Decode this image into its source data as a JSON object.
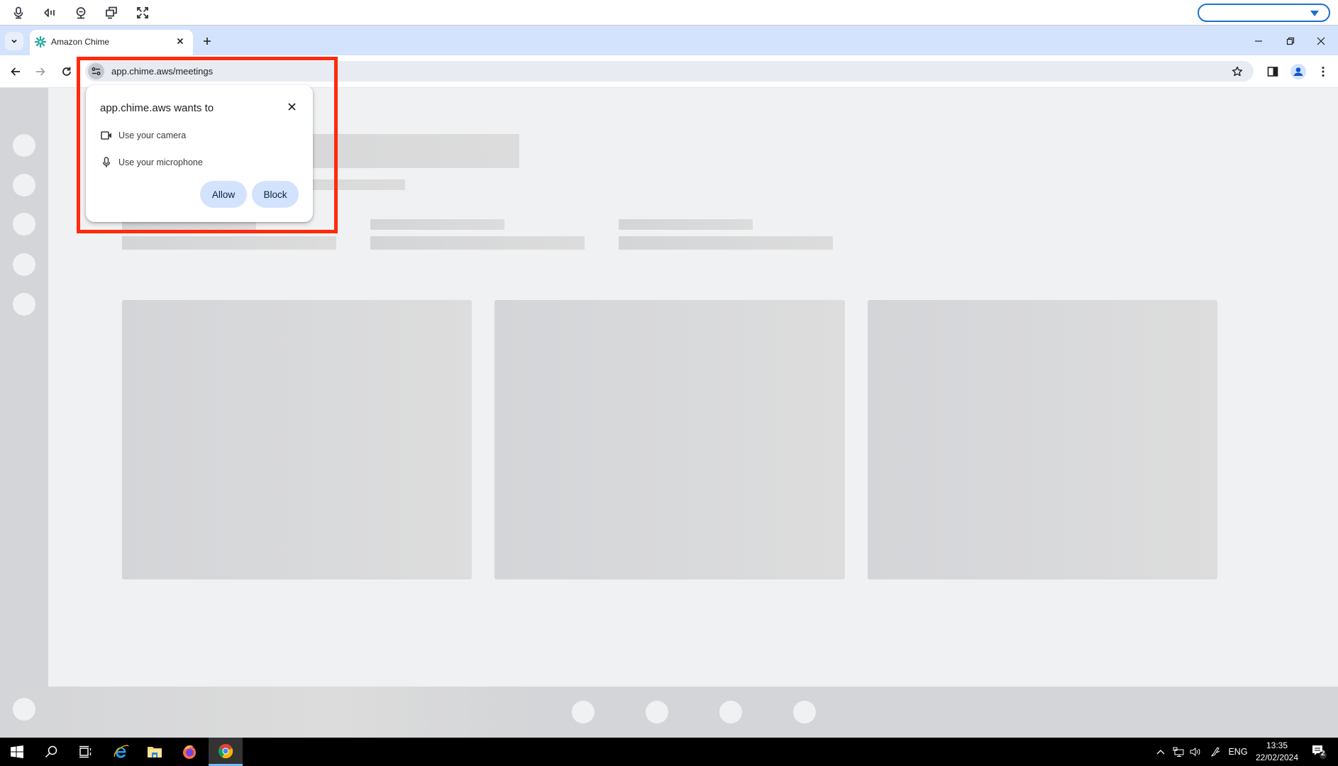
{
  "remote_toolbar": {
    "icons": [
      "microphone-icon",
      "speaker-icon",
      "webcam-icon",
      "multi-monitor-icon",
      "fullscreen-icon"
    ],
    "selector_value": "",
    "accent": "#1a6fd4"
  },
  "browser": {
    "tab": {
      "title": "Amazon Chime",
      "favicon": "chime-logo-icon"
    },
    "new_tab_label": "+",
    "url": "app.chime.aws/meetings",
    "tabstrip_color": "#d3e3fd"
  },
  "permission_prompt": {
    "title": "app.chime.aws wants to",
    "permissions": [
      {
        "icon": "camera-icon",
        "label": "Use your camera"
      },
      {
        "icon": "microphone-icon",
        "label": "Use your microphone"
      }
    ],
    "allow_label": "Allow",
    "block_label": "Block",
    "highlight_color": "#ff2a0c"
  },
  "page": {
    "state": "loading-skeleton",
    "sidebar_placeholder_count": 5,
    "card_placeholder_count": 3,
    "bottom_control_placeholder_count": 4
  },
  "taskbar": {
    "apps": [
      "windows-start",
      "search",
      "task-view",
      "internet-explorer",
      "file-explorer",
      "firefox",
      "chrome"
    ],
    "active_app": "chrome",
    "language": "ENG",
    "time": "13:35",
    "date": "22/02/2024",
    "notification_count": "2"
  }
}
